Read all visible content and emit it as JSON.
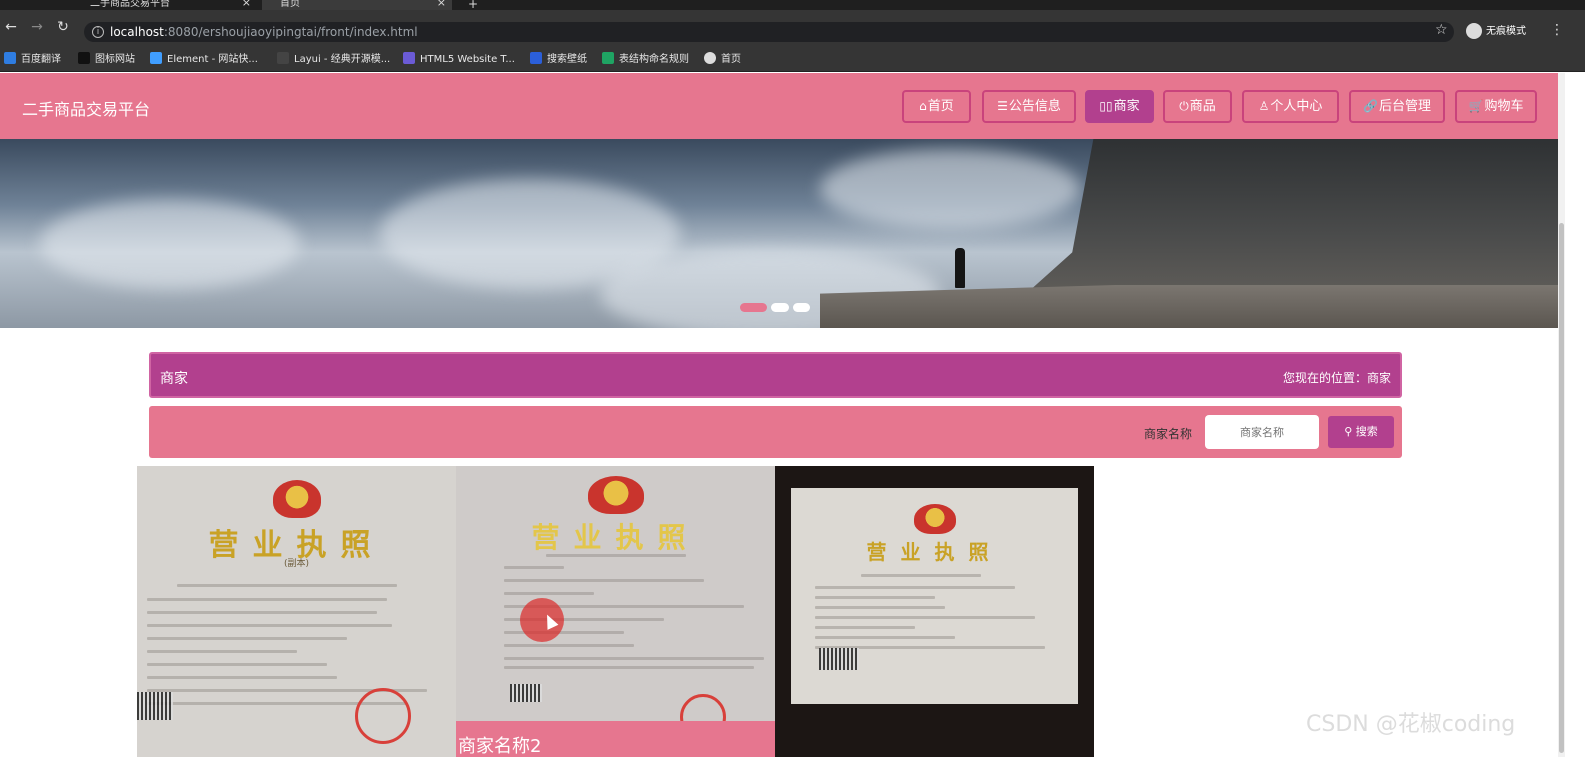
{
  "browser": {
    "tabs": [
      {
        "label": ""
      },
      {
        "label": "二手商品交易平台"
      },
      {
        "label": "首页"
      }
    ],
    "url_host": "localhost",
    "url_path": ":8080/ershoujiaoyipingtai/front/index.html",
    "incognito_label": "无痕模式",
    "bookmarks": [
      "百度翻译",
      "图标网站",
      "Element - 网站快...",
      "Layui - 经典开源模...",
      "HTML5 Website T...",
      "搜索壁纸",
      "表结构命名规则",
      "首页"
    ]
  },
  "site": {
    "title": "二手商品交易平台",
    "nav": [
      {
        "icon": "⌂",
        "label": "首页",
        "active": false
      },
      {
        "icon": "☰",
        "label": "公告信息",
        "active": false
      },
      {
        "icon": "▯▯",
        "label": "商家",
        "active": true
      },
      {
        "icon": "⏻",
        "label": "商品",
        "active": false
      },
      {
        "icon": "♙",
        "label": "个人中心",
        "active": false
      },
      {
        "icon": "🔗",
        "label": "后台管理",
        "active": false
      },
      {
        "icon": "🛒",
        "label": "购物车",
        "active": false
      }
    ]
  },
  "breadcrumb": {
    "title": "商家",
    "location_label": "您现在的位置：商家"
  },
  "search": {
    "label": "商家名称",
    "placeholder": "商家名称",
    "button_label": "搜索"
  },
  "merchants": [
    {
      "license_title": "营业执照",
      "license_sub": "(副本)",
      "caption": ""
    },
    {
      "license_title": "营业执照",
      "license_sub": "",
      "caption": "商家名称2"
    },
    {
      "license_title": "营业执照",
      "license_sub": "",
      "caption": ""
    }
  ],
  "watermark": "CSDN @花椒coding",
  "colors": {
    "primary": "#e6768f",
    "accent": "#b2408e"
  }
}
